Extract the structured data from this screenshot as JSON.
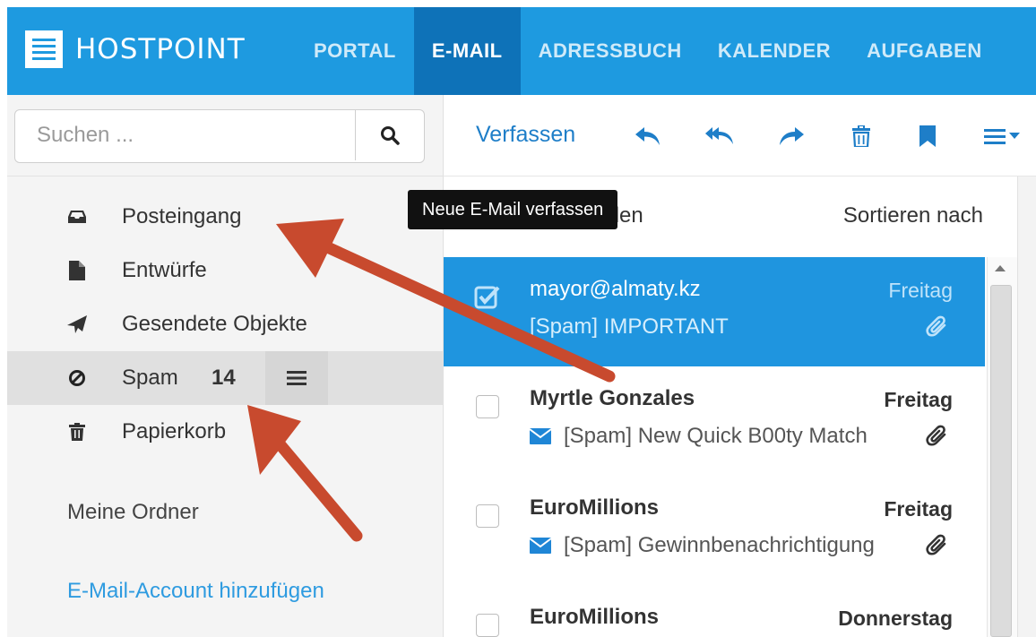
{
  "app": {
    "logo_text": "HOSTPOINT"
  },
  "nav": {
    "items": [
      {
        "label": "PORTAL",
        "active": false
      },
      {
        "label": "E-MAIL",
        "active": true
      },
      {
        "label": "ADRESSBUCH",
        "active": false
      },
      {
        "label": "KALENDER",
        "active": false
      },
      {
        "label": "AUFGABEN",
        "active": false
      }
    ]
  },
  "search": {
    "placeholder": "Suchen ...",
    "value": ""
  },
  "folders": [
    {
      "label": "Posteingang",
      "icon": "inbox-icon"
    },
    {
      "label": "Entwürfe",
      "icon": "file-icon"
    },
    {
      "label": "Gesendete Objekte",
      "icon": "paper-plane-icon"
    },
    {
      "label": "Spam",
      "icon": "ban-icon",
      "count": "14",
      "selected": true
    },
    {
      "label": "Papierkorb",
      "icon": "trash-icon"
    }
  ],
  "sidebar": {
    "my_folders": "Meine Ordner",
    "add_account": "E-Mail-Account hinzufügen"
  },
  "toolbar": {
    "compose": "Verfassen",
    "tooltip": "Neue E-Mail verfassen",
    "icons": [
      "reply-icon",
      "reply-all-icon",
      "forward-icon",
      "trash-icon",
      "bookmark-icon",
      "menu-icon"
    ]
  },
  "list": {
    "select_all": "Alle wählen",
    "sort_label": "Sortieren nach"
  },
  "messages": [
    {
      "sender": "mayor@almaty.kz",
      "date": "Freitag",
      "subject": "[Spam] IMPORTANT",
      "selected": true,
      "attachment": true,
      "unread": false
    },
    {
      "sender": "Myrtle Gonzales",
      "date": "Freitag",
      "subject": "[Spam] New Quick B00ty Match",
      "selected": false,
      "attachment": true,
      "unread": true
    },
    {
      "sender": "EuroMillions",
      "date": "Freitag",
      "subject": "[Spam] Gewinnbenachrichtigung",
      "selected": false,
      "attachment": true,
      "unread": true
    },
    {
      "sender": "EuroMillions",
      "date": "Donnerstag",
      "subject": "",
      "selected": false,
      "attachment": false,
      "unread": true
    }
  ],
  "colors": {
    "brand": "#1e9ae0",
    "nav_active": "#0e72b8",
    "selected_row": "#1f95df",
    "annotation_arrow": "#c84a2e",
    "link": "#2e9be0"
  }
}
